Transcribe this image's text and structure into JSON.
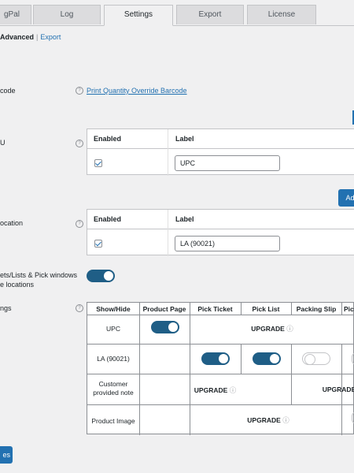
{
  "tabs": [
    {
      "label": "gPal"
    },
    {
      "label": "Log"
    },
    {
      "label": "Settings"
    },
    {
      "label": "Export"
    },
    {
      "label": "License"
    }
  ],
  "subnav": {
    "current": "Advanced",
    "separator": "|",
    "link": "Export"
  },
  "rows": {
    "barcode": {
      "label": "code",
      "link": "Print Quantity Override Barcode"
    },
    "sku": {
      "label": "U"
    },
    "location": {
      "label": "ocation"
    },
    "toggle_row": {
      "label_line1": "ets/Lists & Pick windows",
      "label_line2": "e locations"
    },
    "settings": {
      "label": "ngs"
    }
  },
  "table1": {
    "headers": {
      "enabled": "Enabled",
      "label": "Label"
    },
    "value": "UPC"
  },
  "add_button": {
    "label": "Ad"
  },
  "table2": {
    "headers": {
      "enabled": "Enabled",
      "label": "Label"
    },
    "value": "LA (90021)"
  },
  "grid": {
    "headers": [
      "Show/Hide",
      "Product Page",
      "Pick Ticket",
      "Pick List",
      "Packing Slip",
      "Pic"
    ],
    "rows": [
      {
        "name": "UPC",
        "upgrade": "UPGRADE"
      },
      {
        "name": "LA (90021)"
      },
      {
        "name_line1": "Customer",
        "name_line2": "provided note",
        "upgrade_a": "UPGRADE",
        "upgrade_b": "UPGRADE"
      },
      {
        "name": "Product Image",
        "upgrade": "UPGRADE"
      }
    ]
  },
  "save_button": {
    "label": "es"
  },
  "colors": {
    "accent": "#2271b1",
    "toggle_on": "#1f5e86",
    "background": "#f0f0f1"
  }
}
